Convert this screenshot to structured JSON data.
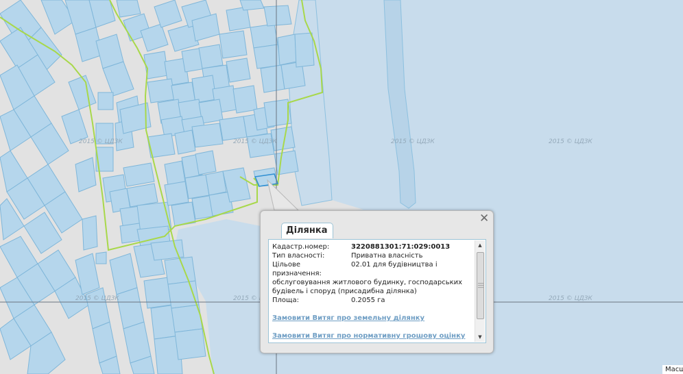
{
  "map": {
    "watermark": "2015 © ЦДЗК",
    "colors": {
      "water": "#c8dcec",
      "land": "#e2e2e2",
      "parcel_fill": "#b5d6ec",
      "parcel_stroke": "#7fb6d9",
      "boundary": "#a8d84a"
    }
  },
  "popup": {
    "tab_title": "Ділянка",
    "close_icon": "close-icon",
    "fields": [
      {
        "key": "Кадастр.номер:",
        "value": "3220881301:71:029:0013",
        "bold": true
      },
      {
        "key": "Тип власності:",
        "value": "Приватна власність",
        "bold": false
      },
      {
        "key": "Цільове призначення:",
        "value": "02.01 для будівництва і",
        "bold": false
      }
    ],
    "purpose_continuation": "обслуговування житлового будинку, господарських будівель і споруд (присадибна ділянка)",
    "area_key": "Площа:",
    "area_value": "0.2055 га",
    "links": [
      "Замовити Витяг про земельну ділянку",
      "Замовити Витяг про нормативну грошову оцінку"
    ]
  },
  "scale_label": "Масш"
}
